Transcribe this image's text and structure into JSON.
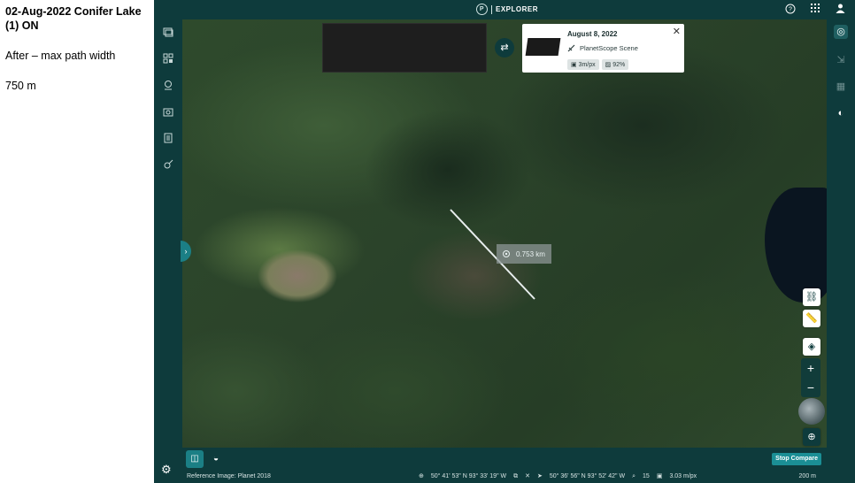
{
  "notes": {
    "title": "02-Aug-2022 Conifer Lake (1) ON",
    "line1": "After – max path width",
    "line2": "750 m"
  },
  "header": {
    "logo_letter": "P",
    "app_name": "EXPLORER"
  },
  "scene_card": {
    "date": "August 8, 2022",
    "type": "PlanetScope Scene",
    "resolution": "3m/px",
    "coverage": "92%"
  },
  "measure": {
    "label": "0.753 km"
  },
  "bottom": {
    "stop_compare": "Stop Compare"
  },
  "status": {
    "reference": "Reference Image: Planet 2018",
    "coord1": "50° 41' 53\" N 93° 33' 19\" W",
    "coord2": "50° 36' 56\" N 93° 52' 42\" W",
    "zoom": "15",
    "resolution": "3.03 m/px",
    "scale": "200 m"
  },
  "colors": {
    "chrome": "#0e3b3c",
    "accent": "#1b7f85"
  }
}
